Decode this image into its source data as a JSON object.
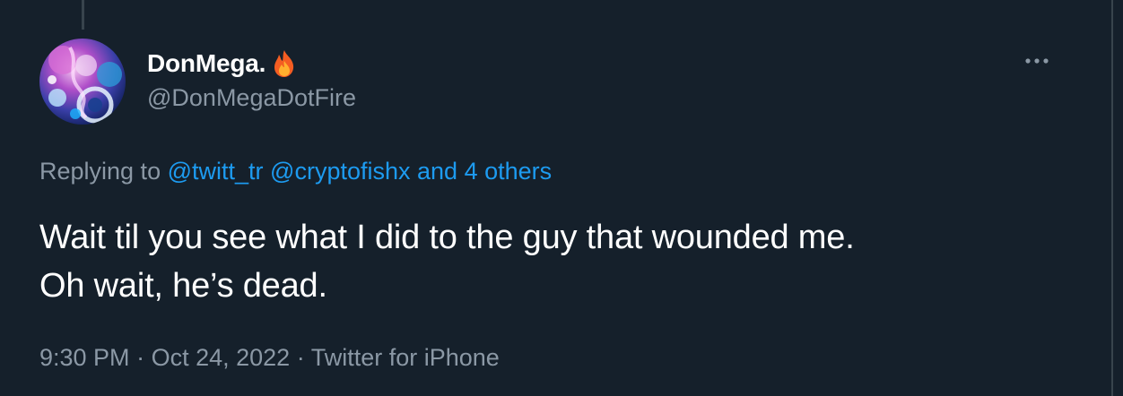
{
  "author": {
    "display_name": "DonMega.",
    "badge_icon": "fire-icon",
    "handle": "@DonMegaDotFire"
  },
  "more_icon": "more-horizontal-icon",
  "reply": {
    "prefix": "Replying to",
    "mentions": [
      "@twitt_tr",
      "@cryptofishx"
    ],
    "others": "and 4 others"
  },
  "tweet": {
    "lines": [
      "Wait til you see what I did to the guy that wounded me.",
      "Oh wait, he’s dead."
    ]
  },
  "meta": {
    "time": "9:30 PM",
    "date": "Oct 24, 2022",
    "source": "Twitter for iPhone",
    "separator": "·"
  },
  "colors": {
    "background": "#15202b",
    "text": "#ffffff",
    "secondary": "#8b98a5",
    "link": "#1d9bf0",
    "border": "#38444d"
  }
}
